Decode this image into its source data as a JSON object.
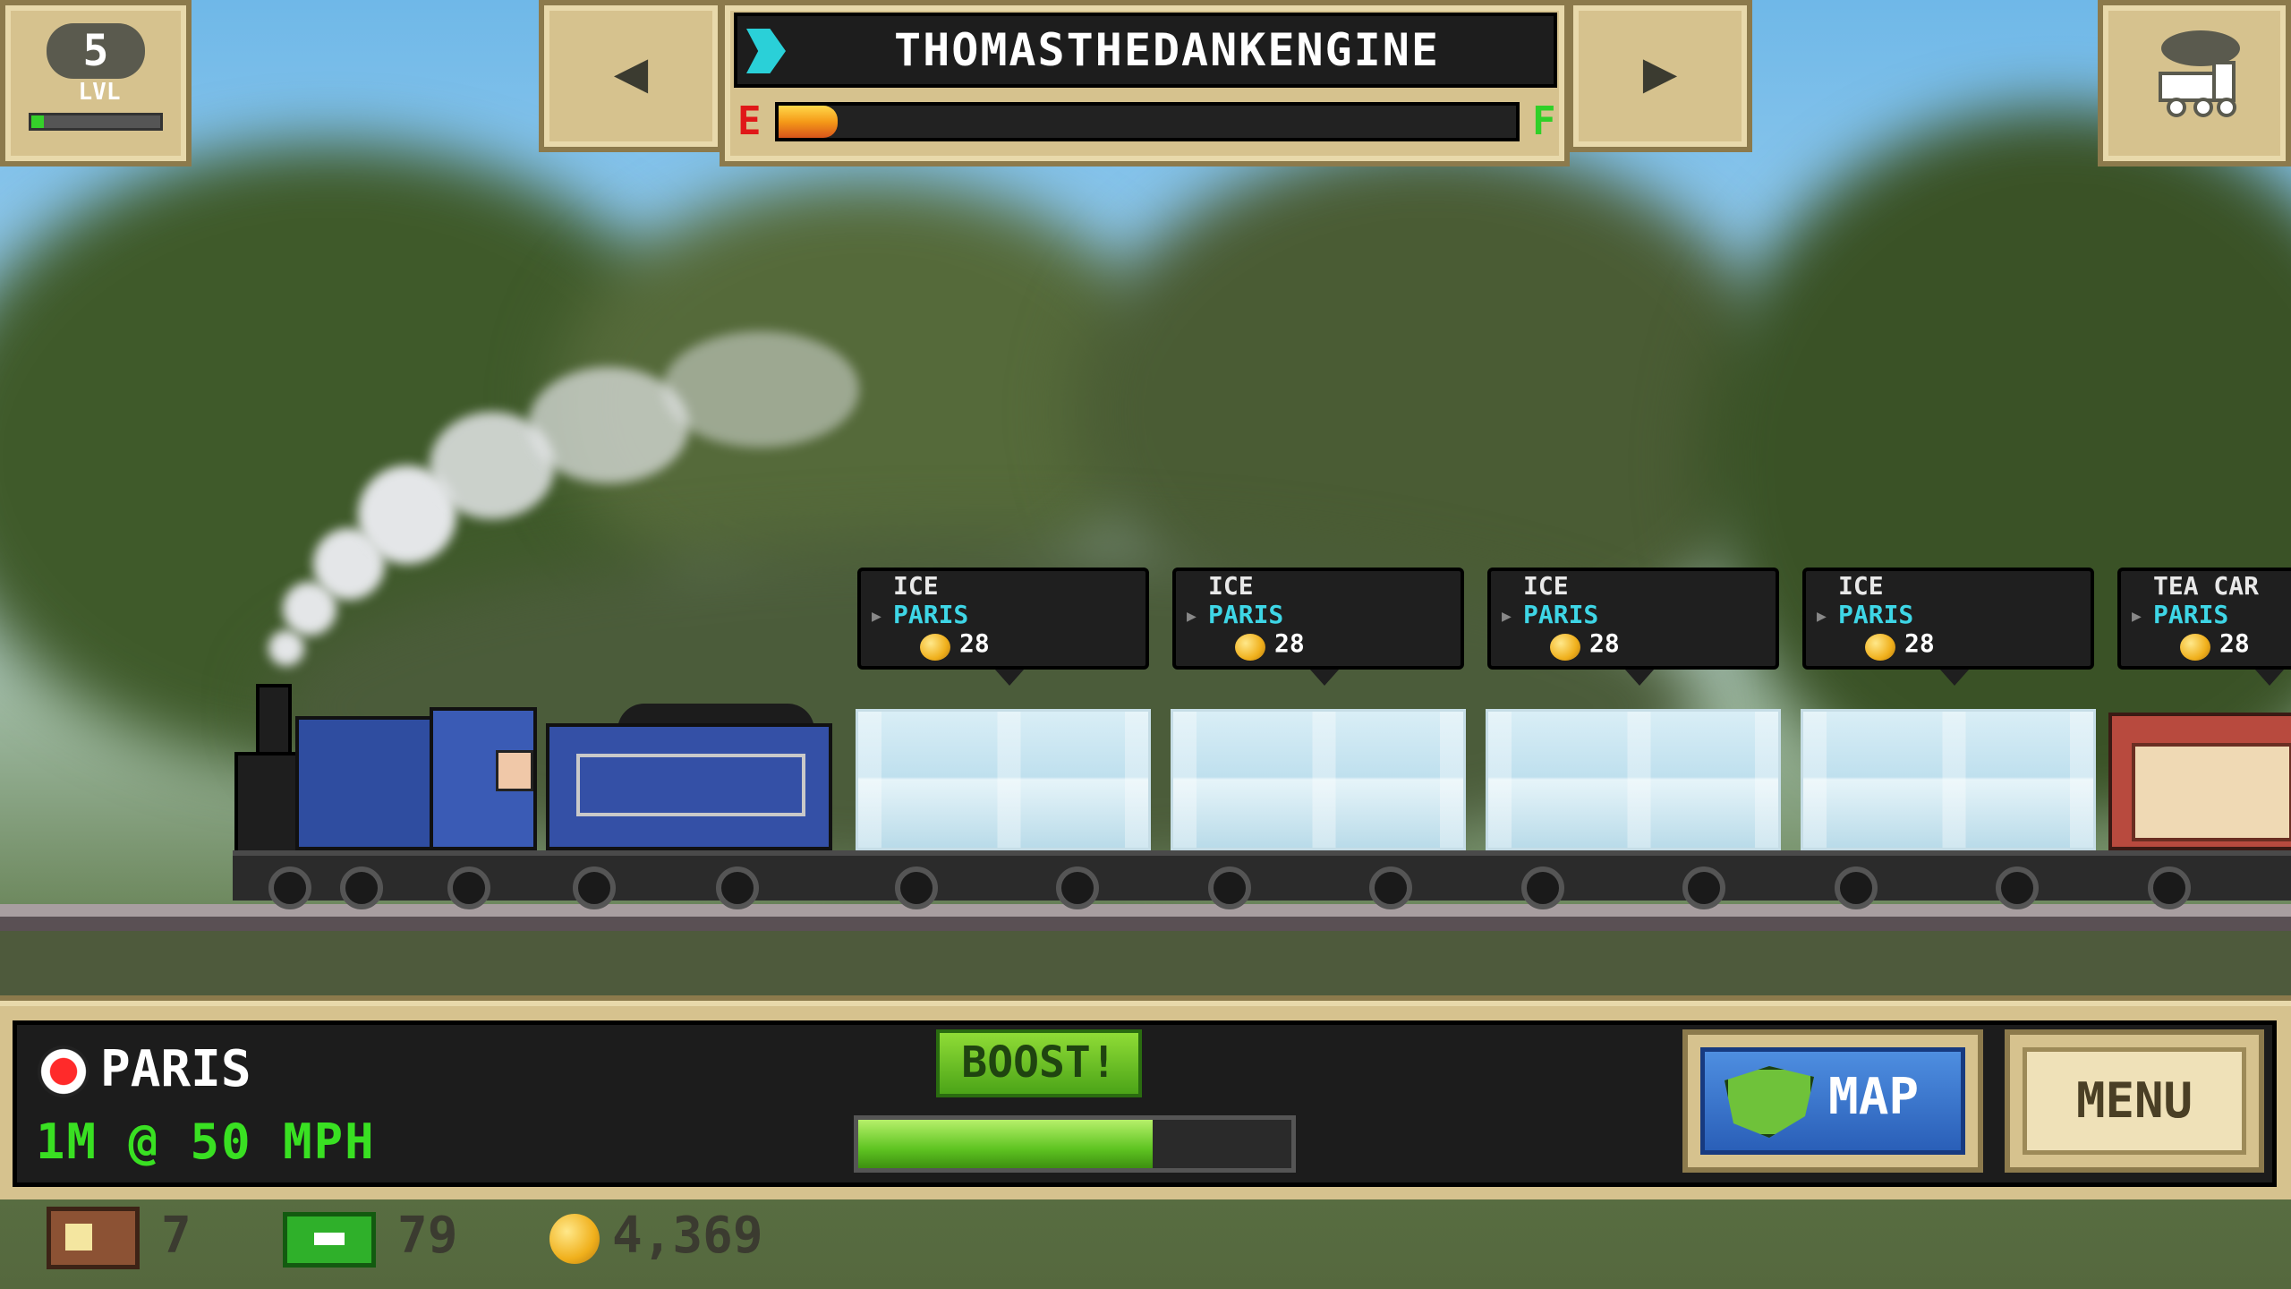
{
  "level": {
    "number": "5",
    "label": "LVL",
    "progress": 0.1
  },
  "train": {
    "name": "THOMASTHEDANKENGINE",
    "fuel_empty_label": "E",
    "fuel_full_label": "F",
    "fuel_level": 0.08
  },
  "cargo": [
    {
      "name": "ICE",
      "destination": "PARIS",
      "reward": "28"
    },
    {
      "name": "ICE",
      "destination": "PARIS",
      "reward": "28"
    },
    {
      "name": "ICE",
      "destination": "PARIS",
      "reward": "28"
    },
    {
      "name": "ICE",
      "destination": "PARIS",
      "reward": "28"
    },
    {
      "name": "TEA CAR",
      "destination": "PARIS",
      "reward": "28"
    }
  ],
  "status": {
    "destination": "PARIS",
    "speed": "1M @ 50 MPH"
  },
  "boost": {
    "label": "BOOST!",
    "charge": 0.68
  },
  "buttons": {
    "map": "MAP",
    "menu": "MENU"
  },
  "resources": {
    "crates": "7",
    "cash": "79",
    "coins": "4,369"
  },
  "icons": {
    "level": "level-badge-icon",
    "prev": "arrow-left-icon",
    "next": "arrow-right-icon",
    "engine": "engine-icon",
    "train_manage": "train-icon",
    "coin": "coin-icon",
    "destination": "destination-marker-icon",
    "map": "map-icon",
    "crate": "crate-icon",
    "cash": "cash-icon"
  },
  "colors": {
    "speed_text": "#39e022",
    "destination_text": "#3ed6e6",
    "fuel_low": "#e01818",
    "fuel_high": "#30d028"
  }
}
